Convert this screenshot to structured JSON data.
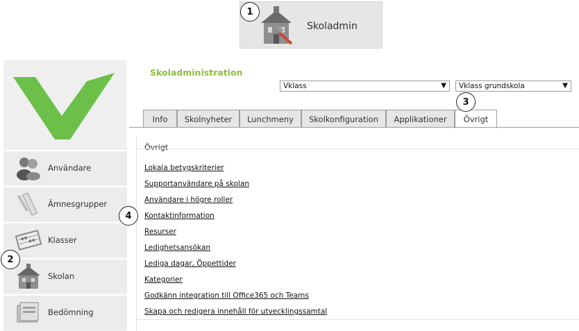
{
  "top_tile": {
    "label": "Skoladmin",
    "icon": "school-house-hammer-icon"
  },
  "badges": [
    "1",
    "2",
    "3",
    "4"
  ],
  "sidebar": {
    "logo": "green-v-logo",
    "items": [
      {
        "label": "Användare",
        "icon": "users-icon"
      },
      {
        "label": "Ämnesgrupper",
        "icon": "ruler-pencil-icon"
      },
      {
        "label": "Klasser",
        "icon": "abacus-icon"
      },
      {
        "label": "Skolan",
        "icon": "school-house-icon"
      },
      {
        "label": "Bedömning",
        "icon": "folder-icon"
      }
    ]
  },
  "main": {
    "title": "Skoladministration",
    "select_left": "Vklass",
    "select_right": "Vklass grundskola",
    "tabs": [
      "Info",
      "Skolnyheter",
      "Lunchmeny",
      "Skolkonfiguration",
      "Applikationer",
      "Övrigt"
    ],
    "active_tab": "Övrigt",
    "section_title": "Övrigt",
    "links": [
      "Lokala betygskriterier",
      "Supportanvändare på skolan",
      "Användare i högre roller",
      "Kontaktinformation",
      "Resurser",
      "Ledighetsansökan",
      "Lediga dagar, Öppettider",
      "Kategorier",
      "Godkänn integration till Office365 och Teams",
      "Skapa och redigera innehåll för utvecklingssamtal"
    ]
  },
  "colors": {
    "accent": "#8cbf3f",
    "logo_green": "#6cc04a"
  }
}
